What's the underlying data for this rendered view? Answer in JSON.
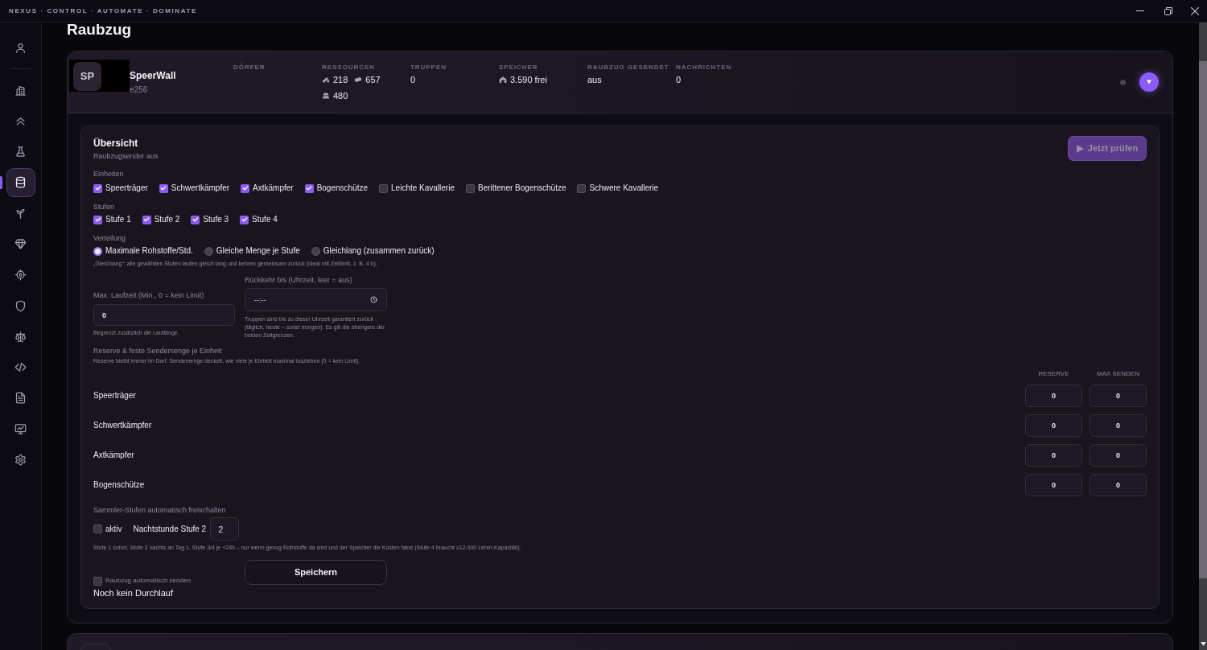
{
  "titlebar": {
    "tagline": "NEXUS · CONTROL · AUTOMATE · DOMINATE"
  },
  "sidebar": {
    "groups": [
      {
        "items": [
          {
            "kind": "user",
            "selected": false
          }
        ]
      },
      {
        "items": [
          {
            "kind": "building",
            "selected": false
          },
          {
            "kind": "chevrons",
            "selected": false
          },
          {
            "kind": "flask",
            "selected": false
          },
          {
            "kind": "database",
            "selected": true
          },
          {
            "kind": "sprout",
            "selected": false
          },
          {
            "kind": "gem",
            "selected": false
          },
          {
            "kind": "target",
            "selected": false
          },
          {
            "kind": "shield",
            "selected": false
          },
          {
            "kind": "scale",
            "selected": false
          },
          {
            "kind": "code",
            "selected": false
          },
          {
            "kind": "file",
            "selected": false
          },
          {
            "kind": "chart",
            "selected": false
          },
          {
            "kind": "gear",
            "selected": false
          }
        ]
      }
    ]
  },
  "page": {
    "title": "Raubzug"
  },
  "villages": [
    {
      "kind": "masked",
      "avatar": "SP",
      "name": "SpeerWall",
      "code": "e256",
      "online": false,
      "expanded": true,
      "stats": [
        {
          "label": "DÖRFER"
        },
        {
          "label": "RESSOURCEN",
          "values": [
            {
              "kind": "wood",
              "text": "218"
            },
            {
              "kind": "clay",
              "text": "657"
            },
            {
              "kind": "iron",
              "text": "480"
            }
          ]
        },
        {
          "label": "TRUPPEN",
          "values": [
            {
              "text": "0"
            }
          ]
        },
        {
          "label": "SPEICHER",
          "values": [
            {
              "kind": "storage",
              "text": "3.590 frei"
            }
          ]
        },
        {
          "label": "RAUBZUG GESENDET",
          "values": [
            {
              "text": "aus"
            }
          ]
        },
        {
          "label": "NACHRICHTEN",
          "values": [
            {
              "text": "0"
            }
          ]
        }
      ],
      "panel": {
        "title": "Übersicht",
        "subtitle": "Raubzugsender aus",
        "check_button": {
          "label": "Jetzt prüfen",
          "disabled": true
        },
        "units": {
          "label": "Einheiten",
          "options": [
            {
              "label": "Speerträger",
              "checked": true
            },
            {
              "label": "Schwertkämpfer",
              "checked": true
            },
            {
              "label": "Axtkämpfer",
              "checked": true
            },
            {
              "label": "Bogenschütze",
              "checked": true
            },
            {
              "label": "Leichte Kavallerie",
              "checked": false
            },
            {
              "label": "Berittener Bogenschütze",
              "checked": false
            },
            {
              "label": "Schwere Kavallerie",
              "checked": false
            }
          ]
        },
        "levels": {
          "label": "Stufen",
          "options": [
            {
              "label": "Stufe 1",
              "checked": true
            },
            {
              "label": "Stufe 2",
              "checked": true
            },
            {
              "label": "Stufe 3",
              "checked": true
            },
            {
              "label": "Stufe 4",
              "checked": true
            }
          ]
        },
        "distribution": {
          "label": "Verteilung",
          "options": [
            {
              "label": "Maximale Rohstoffe/Std.",
              "selected": true
            },
            {
              "label": "Gleiche Menge je Stufe",
              "selected": false
            },
            {
              "label": "Gleichlang (zusammen zurück)",
              "selected": false
            }
          ],
          "note": "„Gleichlang“: alle gewählten Stufen laufen gleich lang und kehren gemeinsam zurück (ideal mit Zeitlimit, z. B. 4 h)."
        },
        "max_runtime": {
          "label": "Max. Laufzeit (Min., 0 = kein Limit)",
          "value": "0",
          "hint": "Begrenzt zusätzlich die Lauflänge."
        },
        "return_by": {
          "label": "Rückkehr bis (Uhrzeit, leer = aus)",
          "placeholder": "--:--",
          "hint": "Truppen sind bis zu dieser Uhrzeit garantiert zurück (täglich, heute – sonst morgen). Es gilt die strengere der beiden Zeitgrenzen."
        },
        "reserve": {
          "title": "Reserve & feste Sendemenge je Einheit",
          "note": "Reserve bleibt immer im Dorf. Sendemenge deckelt, wie viele je Einheit maximal losziehen (0 = kein Limit).",
          "columns": [
            "RESERVE",
            "MAX SENDEN"
          ],
          "rows": [
            {
              "unit": "Speerträger",
              "reserve": "0",
              "max_send": "0"
            },
            {
              "unit": "Schwertkämpfer",
              "reserve": "0",
              "max_send": "0"
            },
            {
              "unit": "Axtkämpfer",
              "reserve": "0",
              "max_send": "0"
            },
            {
              "unit": "Bogenschütze",
              "reserve": "0",
              "max_send": "0"
            }
          ]
        },
        "auto_unlock": {
          "title": "Sammler-Stufen automatisch freischalten",
          "toggle": {
            "label": "aktiv",
            "checked": false
          },
          "night_hour": {
            "label": "Nachtstunde Stufe 2",
            "value": "2"
          },
          "note": "Stufe 1 sofort, Stufe 2 nachts an Tag 1, Stufe 3/4 je +24h – nur wenn genug Rohstoffe da sind und der Speicher die Kosten fasst (Stufe 4 braucht ≥12.000 Lehm-Kapazität)."
        },
        "auto_send": {
          "label": "Raubzug automatisch senden",
          "checked": false
        },
        "last_run": "Noch kein Durchlauf",
        "save_button": {
          "label": "Speichern"
        }
      }
    },
    {
      "kind": "plain"
    }
  ]
}
